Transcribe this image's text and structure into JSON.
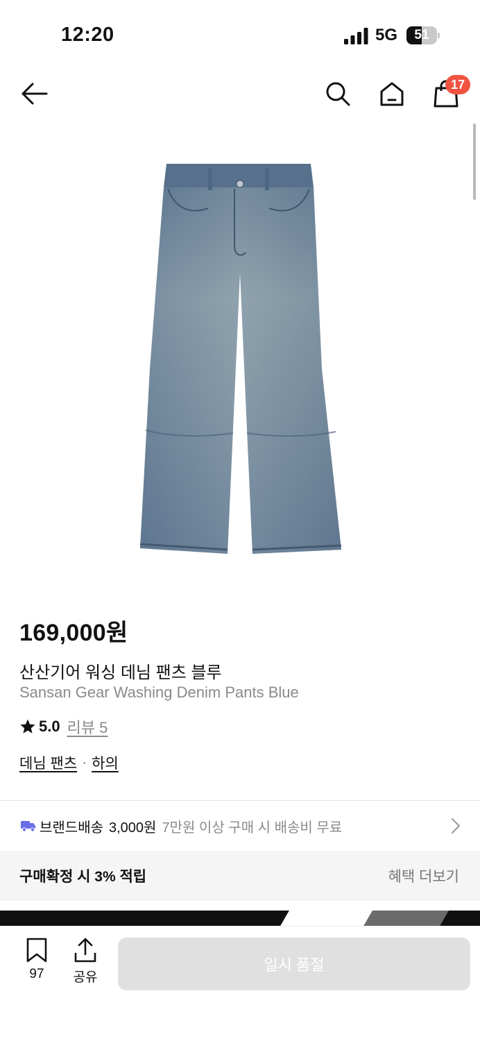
{
  "status_bar": {
    "time": "12:20",
    "network": "5G",
    "battery_level": "51",
    "battery_fraction": 0.51
  },
  "nav": {
    "back_icon": "arrow-left-icon",
    "search_icon": "search-icon",
    "home_icon": "home-icon",
    "cart_icon": "shopping-bag-icon",
    "cart_count": "17",
    "badge_color": "#f05340"
  },
  "product": {
    "image": "light-blue washed denim wide pants",
    "price": "169,000원",
    "title_ko": "산산기어 워싱 데님 팬츠 블루",
    "title_en": "Sansan Gear Washing Denim Pants Blue",
    "rating": "5.0",
    "review_label": "리뷰 5",
    "categories": [
      "데님 팬츠",
      "하의"
    ],
    "category_separator": "·"
  },
  "shipping": {
    "icon": "truck-icon",
    "icon_color": "#6a6ee8",
    "label": "브랜드배송",
    "fee": "3,000원",
    "note": "7만원 이상 구매 시 배송비 무료"
  },
  "benefit": {
    "label": "구매확정 시 3% 적립",
    "more": "혜택 더보기"
  },
  "bottom_bar": {
    "bookmark_count": "97",
    "share_label": "공유",
    "primary_button": "일시 품절"
  }
}
